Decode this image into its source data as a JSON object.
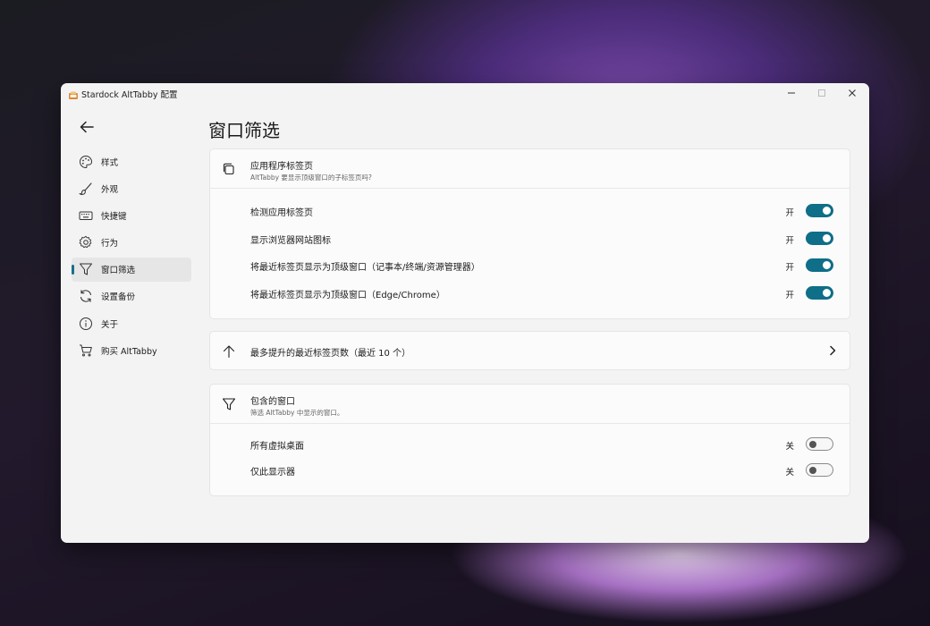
{
  "window": {
    "title": "Stardock AltTabby 配置"
  },
  "nav": {
    "items": [
      {
        "label": "样式",
        "icon": "palette-icon"
      },
      {
        "label": "外观",
        "icon": "brush-icon"
      },
      {
        "label": "快捷键",
        "icon": "keyboard-icon"
      },
      {
        "label": "行为",
        "icon": "gear-icon"
      },
      {
        "label": "窗口筛选",
        "icon": "filter-icon",
        "active": true
      },
      {
        "label": "设置备份",
        "icon": "sync-icon"
      },
      {
        "label": "关于",
        "icon": "info-icon"
      },
      {
        "label": "购买 AltTabby",
        "icon": "cart-icon"
      }
    ]
  },
  "page": {
    "title": "窗口筛选"
  },
  "app_tabs": {
    "title": "应用程序标签页",
    "subtitle": "AltTabby 要显示顶级窗口的子标签页吗?",
    "rows": [
      {
        "label": "检测应用标签页",
        "state": "开",
        "on": true
      },
      {
        "label": "显示浏览器网站图标",
        "state": "开",
        "on": true
      },
      {
        "label": "将最近标签页显示为顶级窗口（记事本/终端/资源管理器）",
        "state": "开",
        "on": true
      },
      {
        "label": "将最近标签页显示为顶级窗口（Edge/Chrome）",
        "state": "开",
        "on": true
      }
    ]
  },
  "promote": {
    "label": "最多提升的最近标签页数（最近 10 个）"
  },
  "included": {
    "title": "包含的窗口",
    "subtitle": "筛选 AltTabby 中显示的窗口。",
    "rows": [
      {
        "label": "所有虚拟桌面",
        "state": "关",
        "on": false
      },
      {
        "label": "仅此显示器",
        "state": "关",
        "on": false
      }
    ]
  },
  "colors": {
    "accent": "#0f6e88",
    "window_bg": "#f3f3f3",
    "card_bg": "#fbfbfb"
  }
}
